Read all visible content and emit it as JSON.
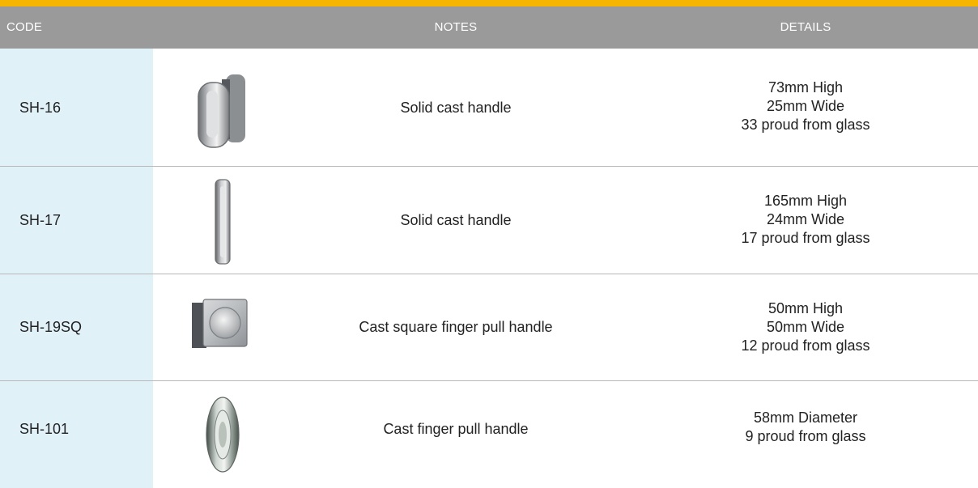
{
  "header": {
    "code": "CODE",
    "notes": "NOTES",
    "details": "DETAILS"
  },
  "colors": {
    "accent_bar": "#f7b500",
    "header_bg": "#9a9a9a",
    "code_column_bg": "#e1f1f8"
  },
  "rows": [
    {
      "code": "SH-16",
      "image": "oval-handle-image",
      "note": "Solid cast handle",
      "details": [
        "73mm High",
        "25mm Wide",
        "33 proud from glass"
      ]
    },
    {
      "code": "SH-17",
      "image": "long-bar-handle-image",
      "note": "Solid cast handle",
      "details": [
        "165mm High",
        "24mm Wide",
        "17 proud from glass"
      ]
    },
    {
      "code": "SH-19SQ",
      "image": "square-finger-pull-image",
      "note": "Cast square finger pull handle",
      "details": [
        "50mm High",
        "50mm Wide",
        "12 proud from glass"
      ]
    },
    {
      "code": "SH-101",
      "image": "round-finger-pull-image",
      "note": "Cast finger pull handle",
      "details": [
        "58mm Diameter",
        "9 proud from glass"
      ]
    }
  ]
}
